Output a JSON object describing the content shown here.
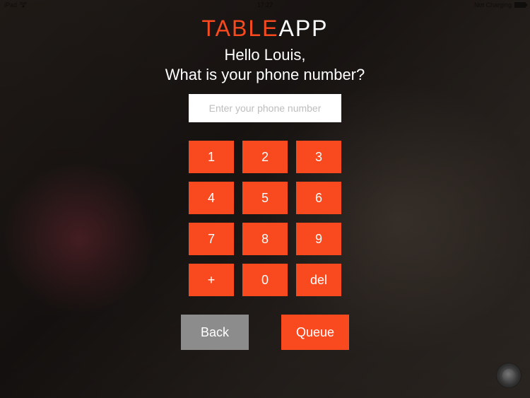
{
  "status": {
    "carrier": "iPad",
    "time": "17:27",
    "charging_label": "Not Charging"
  },
  "logo": {
    "part1": "TABLE",
    "part2": "APP"
  },
  "greeting": "Hello Louis,",
  "question": "What is your phone number?",
  "phone_input": {
    "placeholder": "Enter your phone number",
    "value": ""
  },
  "keypad": {
    "k1": "1",
    "k2": "2",
    "k3": "3",
    "k4": "4",
    "k5": "5",
    "k6": "6",
    "k7": "7",
    "k8": "8",
    "k9": "9",
    "kplus": "+",
    "k0": "0",
    "kdel": "del"
  },
  "actions": {
    "back": "Back",
    "queue": "Queue"
  },
  "colors": {
    "accent": "#F94A1F",
    "back_button": "#8c8c8c"
  }
}
